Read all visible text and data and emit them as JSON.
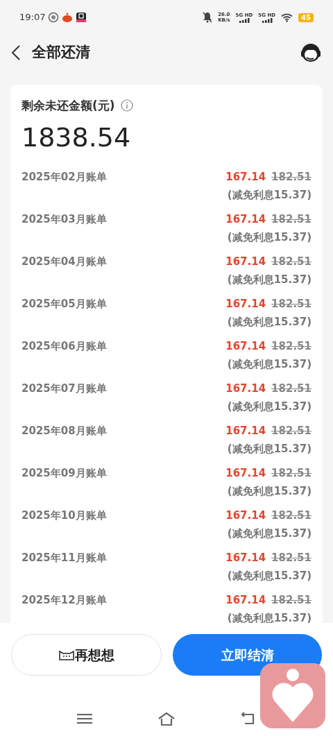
{
  "status_bar": {
    "time": "19:07",
    "net_speed": "26.0",
    "net_unit": "KB/s",
    "sim_labels": [
      "5G HD",
      "5G HD"
    ],
    "battery": "45"
  },
  "header": {
    "title": "全部还清"
  },
  "summary": {
    "title": "剩余未还金额(元)",
    "amount": "1838.54"
  },
  "bills": [
    {
      "period": "2025年02月账单",
      "amount": "167.14",
      "original": "182.51",
      "note": "(减免利息15.37)"
    },
    {
      "period": "2025年03月账单",
      "amount": "167.14",
      "original": "182.51",
      "note": "(减免利息15.37)"
    },
    {
      "period": "2025年04月账单",
      "amount": "167.14",
      "original": "182.51",
      "note": "(减免利息15.37)"
    },
    {
      "period": "2025年05月账单",
      "amount": "167.14",
      "original": "182.51",
      "note": "(减免利息15.37)"
    },
    {
      "period": "2025年06月账单",
      "amount": "167.14",
      "original": "182.51",
      "note": "(减免利息15.37)"
    },
    {
      "period": "2025年07月账单",
      "amount": "167.14",
      "original": "182.51",
      "note": "(减免利息15.37)"
    },
    {
      "period": "2025年08月账单",
      "amount": "167.14",
      "original": "182.51",
      "note": "(减免利息15.37)"
    },
    {
      "period": "2025年09月账单",
      "amount": "167.14",
      "original": "182.51",
      "note": "(减免利息15.37)"
    },
    {
      "period": "2025年10月账单",
      "amount": "167.14",
      "original": "182.51",
      "note": "(减免利息15.37)"
    },
    {
      "period": "2025年11月账单",
      "amount": "167.14",
      "original": "182.51",
      "note": "(减免利息15.37)"
    },
    {
      "period": "2025年12月账单",
      "amount": "167.14",
      "original": "182.51",
      "note": "(减免利息15.37)"
    }
  ],
  "buttons": [
    {
      "label": "再想想",
      "kind": "secondary"
    },
    {
      "label": "立即结清",
      "kind": "primary"
    }
  ]
}
